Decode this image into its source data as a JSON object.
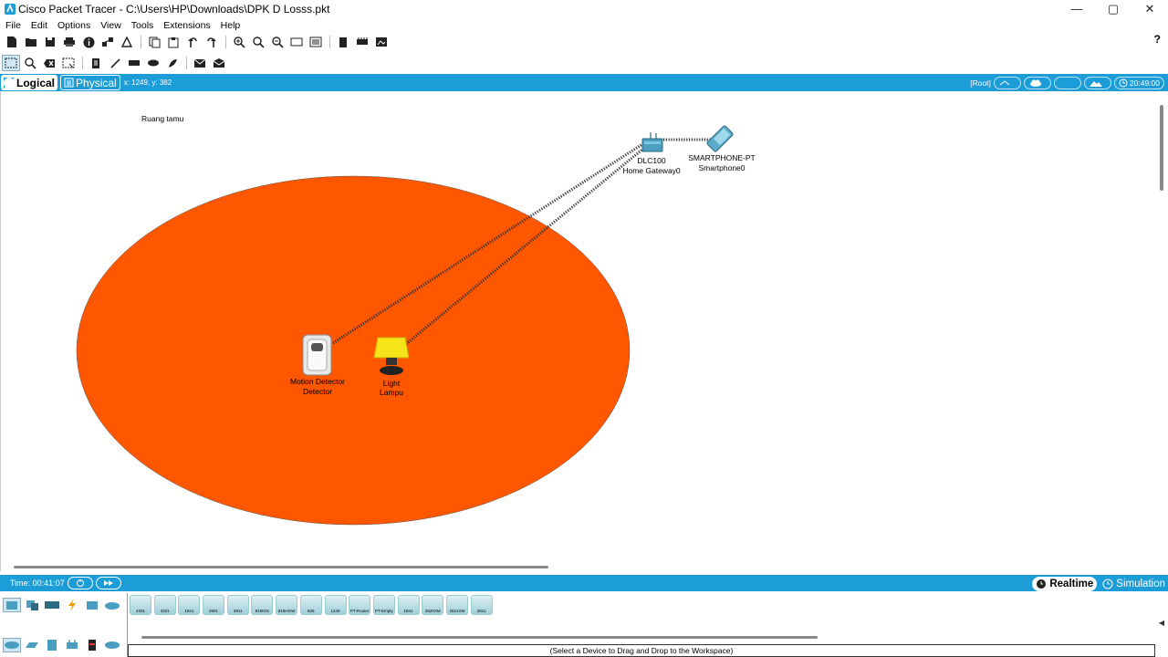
{
  "window": {
    "title": "Cisco Packet Tracer - C:\\Users\\HP\\Downloads\\DPK D Losss.pkt",
    "controls": [
      "—",
      "▢",
      "✕"
    ]
  },
  "menu": [
    "File",
    "Edit",
    "Options",
    "View",
    "Tools",
    "Extensions",
    "Help"
  ],
  "toolbar": {
    "help": "?"
  },
  "viewbar": {
    "logical": "Logical",
    "physical": "Physical",
    "coords": "x: 1249, y: 382",
    "root": "[Root]",
    "clock": "20:49:00"
  },
  "workspace": {
    "note": "Ruang tamu",
    "devices": [
      {
        "line1": "DLC100",
        "line2": "Home Gateway0"
      },
      {
        "line1": "SMARTPHONE-PT",
        "line2": "Smartphone0"
      },
      {
        "line1": "Motion Detector",
        "line2": "Detector"
      },
      {
        "line1": "Light",
        "line2": "Lampu"
      }
    ],
    "area_color": "#ff5600"
  },
  "statusbar": {
    "time": "Time: 00:41:07",
    "realtime": "Realtime",
    "simulation": "Simulation"
  },
  "device_list": [
    "4331",
    "4321",
    "1941",
    "2901",
    "2911",
    "819IOX",
    "819HGW",
    "829",
    "1240",
    "PT-Router",
    "PT-Empty",
    "1841",
    "2620XM",
    "2621XM",
    "2811"
  ],
  "bottom_status": "(Select a Device to Drag and Drop to the Workspace)"
}
